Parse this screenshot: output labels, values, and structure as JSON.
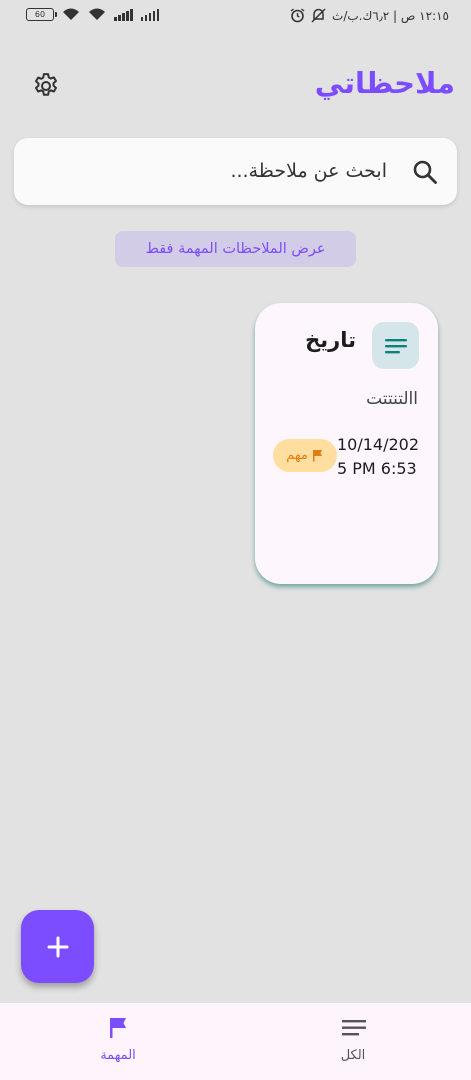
{
  "status_bar": {
    "battery": "60",
    "time_text": "١٢:١٥ ص | ٦٫٢ك.ب/ث"
  },
  "header": {
    "title": "ملاحظاتي"
  },
  "search": {
    "placeholder": "ابحث عن ملاحظة..."
  },
  "filter": {
    "label": "عرض الملاحظات المهمة فقط"
  },
  "notes": [
    {
      "title": "تاريخ",
      "body": "االتنتتت",
      "date": "10/14/2025 PM 6:53",
      "badge": "مهم"
    }
  ],
  "bottom_nav": {
    "important_label": "المهمة",
    "all_label": "الكل"
  },
  "colors": {
    "accent": "#7c4dff",
    "badge_bg": "#ffdea0",
    "badge_text": "#e27e0f",
    "note_icon_bg": "#d5e6ea",
    "note_icon_fg": "#0f7f7a"
  },
  "icons": {
    "settings": "gear-icon",
    "search": "search-icon",
    "note": "notes-list-icon",
    "badge": "flag-icon",
    "fab": "plus-icon",
    "nav_important": "flag-icon",
    "nav_all": "list-icon"
  }
}
